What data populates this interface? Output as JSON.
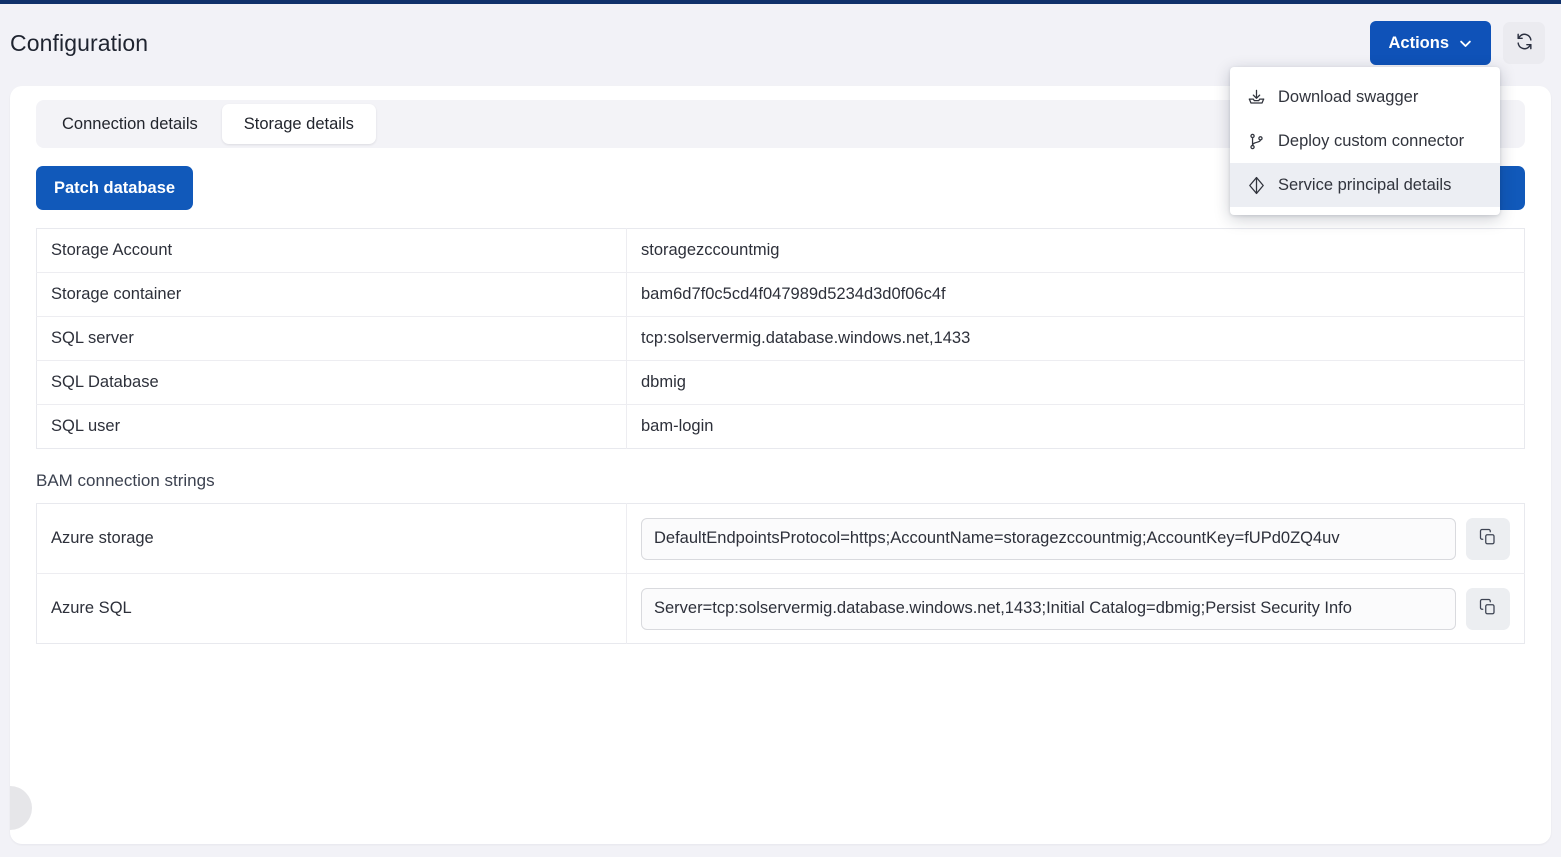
{
  "header": {
    "title": "Configuration",
    "actions_button": {
      "label": "Actions",
      "icon": "chevron-down-icon"
    },
    "refresh_button": {
      "icon": "refresh-icon"
    },
    "accent_blue": "#0f52b8",
    "top_border_color": "#10316b"
  },
  "actions_menu": {
    "items": [
      {
        "label": "Download swagger",
        "icon": "download-tray-icon",
        "active": false
      },
      {
        "label": "Deploy custom connector",
        "icon": "git-branch-icon",
        "active": false
      },
      {
        "label": "Service principal details",
        "icon": "diamond-outline-icon",
        "active": true
      }
    ]
  },
  "tabs": [
    {
      "label": "Connection details",
      "selected": false
    },
    {
      "label": "Storage details",
      "selected": true
    }
  ],
  "toolbar": {
    "patch_database_label": "Patch database"
  },
  "storage_details": {
    "rows": [
      {
        "key": "Storage Account",
        "value": "storagezccountmig"
      },
      {
        "key": "Storage container",
        "value": "bam6d7f0c5cd4f047989d5234d3d0f06c4f"
      },
      {
        "key": "SQL server",
        "value": "tcp:solservermig.database.windows.net,1433"
      },
      {
        "key": "SQL Database",
        "value": "dbmig"
      },
      {
        "key": "SQL user",
        "value": "bam-login"
      }
    ]
  },
  "connection_strings": {
    "section_title": "BAM connection strings",
    "rows": [
      {
        "key": "Azure storage",
        "value": "DefaultEndpointsProtocol=https;AccountName=storagezccountmig;AccountKey=fUPd0ZQ4uv",
        "copy_icon": "copy-icon"
      },
      {
        "key": "Azure SQL",
        "value": "Server=tcp:solservermig.database.windows.net,1433;Initial Catalog=dbmig;Persist Security Info",
        "copy_icon": "copy-icon"
      }
    ]
  }
}
